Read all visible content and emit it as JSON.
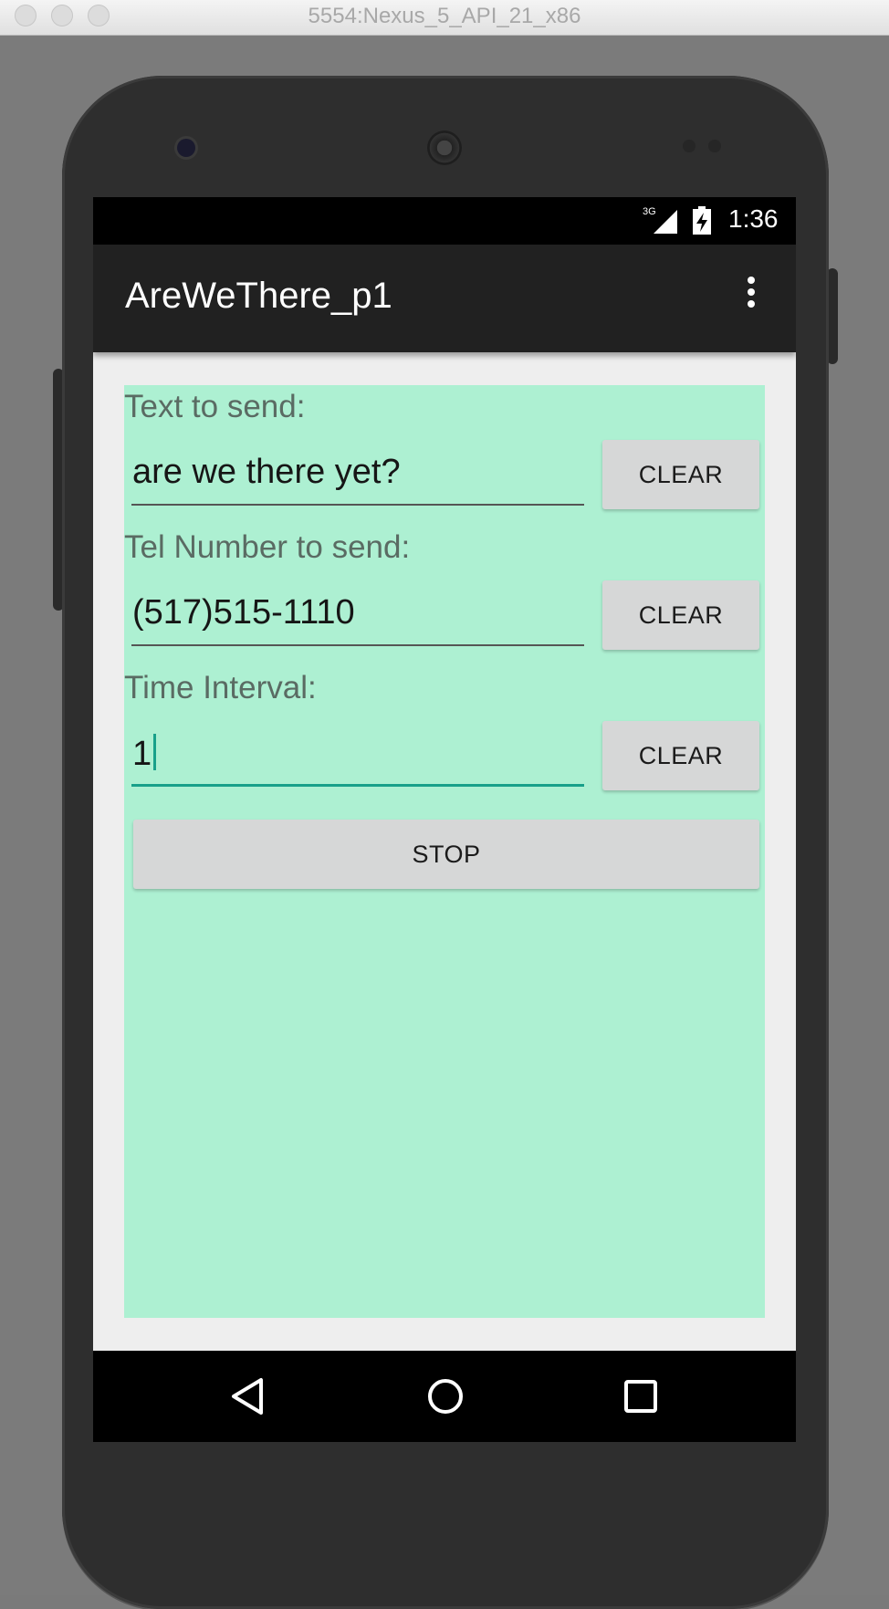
{
  "window": {
    "title": "5554:Nexus_5_API_21_x86"
  },
  "statusbar": {
    "network_label": "3G",
    "network_icon": "signal-3g-icon",
    "battery_icon": "battery-charging-icon",
    "time": "1:36"
  },
  "appbar": {
    "title": "AreWeThere_p1",
    "menu_icon": "overflow-menu-icon"
  },
  "form": {
    "text_label": "Text to send:",
    "text_value": "are we there yet?",
    "tel_label": "Tel Number to send:",
    "tel_value": "(517)515-1110",
    "interval_label": "Time Interval:",
    "interval_value": "1",
    "clear_label": "CLEAR",
    "stop_label": "STOP"
  },
  "navbar": {
    "back_icon": "back-icon",
    "home_icon": "home-icon",
    "recents_icon": "recents-icon"
  },
  "colors": {
    "content_bg": "#adf0d2",
    "appbar_bg": "#212121",
    "accent": "#18a08a"
  }
}
